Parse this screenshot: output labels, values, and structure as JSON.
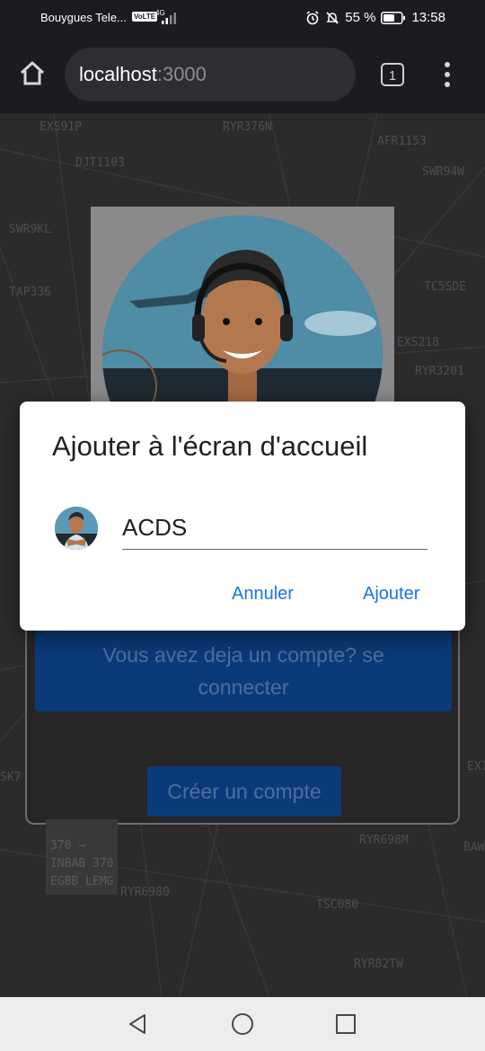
{
  "status_bar": {
    "carrier": "Bouygues Tele...",
    "volte": "VoLTE",
    "network": "4G",
    "battery": "55 %",
    "time": "13:58"
  },
  "browser": {
    "url_host": "localhost",
    "url_port": ":3000",
    "tab_count": "1"
  },
  "background_page": {
    "login_button": "Vous avez deja un compte? se connecter",
    "create_button": "Créer un compte",
    "map_labels": [
      "EXS91P",
      "RYR376N",
      "AFR1153",
      "DJT1103",
      "SWR94W",
      "SWR9KL",
      "TAP336",
      "TC5SDE",
      "EXS218",
      "RYR3201",
      "BAW",
      "RYR698M",
      "RYR6980",
      "TSC080",
      "RYR82TW",
      "SK7",
      "EX1"
    ],
    "flight_box": [
      "370 →",
      "INBAB 370",
      "EGBB LEMG"
    ]
  },
  "dialog": {
    "title": "Ajouter à l'écran d'accueil",
    "app_name": "ACDS",
    "cancel_label": "Annuler",
    "add_label": "Ajouter"
  },
  "colors": {
    "accent": "#1a73e8",
    "page_button": "#0b3a78"
  }
}
